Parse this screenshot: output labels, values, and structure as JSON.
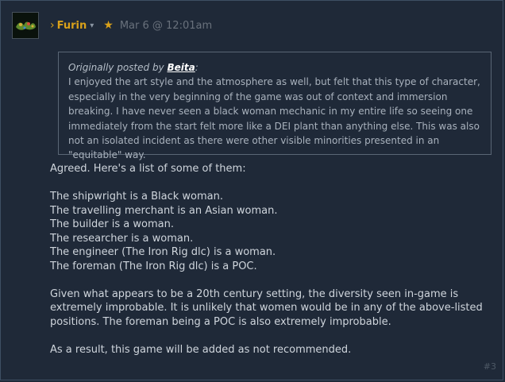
{
  "post": {
    "author": "Furin",
    "author_prefix": "›",
    "dropdown_caret": "▾",
    "star": "★",
    "date": "Mar 6 @ 12:01am",
    "post_number": "#3"
  },
  "quote": {
    "prefix": "Originally posted by ",
    "user": "Beita",
    "suffix": ":",
    "text": "I enjoyed the art style and the atmosphere as well, but felt that this type of character, especially in the very beginning of the game was out of context and immersion breaking. I have never seen a black woman mechanic in my entire life so seeing one immediately from the start felt more like a DEI plant than anything else. This was also not an isolated incident as there were other visible minorities presented in an \"equitable\" way."
  },
  "body": {
    "intro": "Agreed. Here's a list of some of them:",
    "list": [
      "The shipwright is a Black woman.",
      "The travelling merchant is an Asian woman.",
      "The builder is a woman.",
      "The researcher is a woman.",
      "The engineer (The Iron Rig dlc) is a woman.",
      "The foreman (The Iron Rig dlc) is a POC."
    ],
    "paragraph": "Given what appears to be a 20th century setting, the diversity seen in-game is extremely improbable. It is unlikely that women would be in any of the above-listed positions. The foreman being a POC is also extremely improbable.",
    "conclusion": "As a result, this game will be added as not recommended."
  },
  "colors": {
    "author": "#d9a11a",
    "background": "#1f2938",
    "text": "#cfd5dc"
  }
}
